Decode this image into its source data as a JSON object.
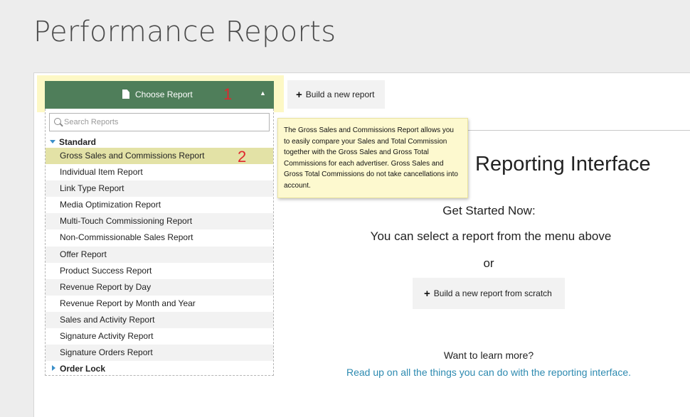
{
  "page_title": "Performance Reports",
  "toolbar": {
    "choose_report_label": "Choose Report",
    "build_new_label": "Build a new report"
  },
  "annotations": {
    "step1": "1",
    "step2": "2"
  },
  "search": {
    "placeholder": "Search Reports"
  },
  "groups": {
    "standard": "Standard",
    "order_lock": "Order Lock"
  },
  "reports": [
    "Gross Sales and Commissions Report",
    "Individual Item Report",
    "Link Type Report",
    "Media Optimization Report",
    "Multi-Touch Commissioning Report",
    "Non-Commissionable Sales Report",
    "Offer Report",
    "Product Success Report",
    "Revenue Report by Day",
    "Revenue Report by Month and Year",
    "Sales and Activity Report",
    "Signature Activity Report",
    "Signature Orders Report"
  ],
  "tooltip": "The Gross Sales and Commissions Report allows you to easily compare your Sales and Total Commission together with the Gross Sales and Gross Total Commissions for each advertiser. Gross Sales and Gross Total Commissions do not take cancellations into account.",
  "main": {
    "heading": "Reporting Interface",
    "get_started": "Get Started Now:",
    "select_text": "You can select a report from the menu above",
    "or_text": "or",
    "build_scratch_label": "Build a new report from scratch",
    "learn_more": "Want to learn more?",
    "learn_link": "Read up on all the things you can do with the reporting interface."
  },
  "colors": {
    "choose_button": "#4f7e5a",
    "highlight": "#fdf8c5",
    "tooltip_bg": "#fdf9cf",
    "link": "#2d8ab0",
    "annotation": "#e0282e"
  }
}
